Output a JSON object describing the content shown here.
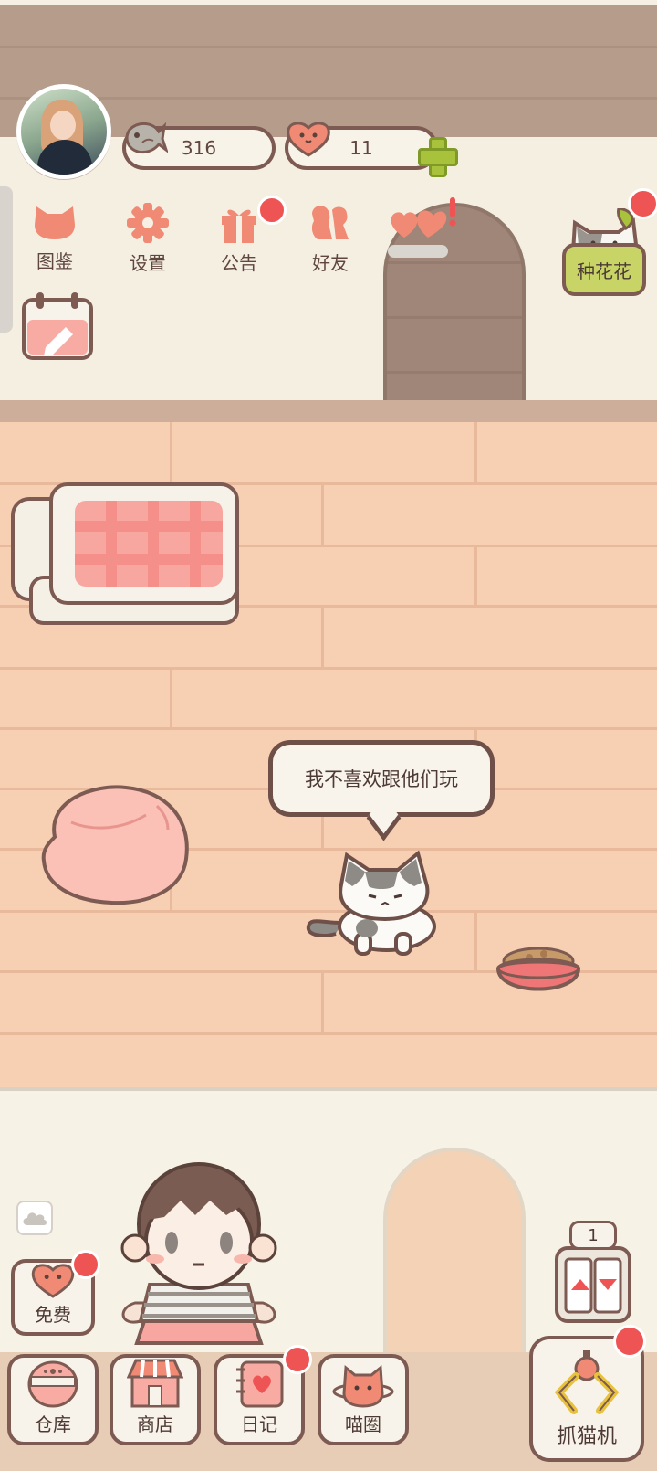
{
  "hud": {
    "fish_count": "316",
    "heart_count": "11"
  },
  "menu": {
    "items": [
      {
        "label": "图鉴",
        "icon": "cat-head-icon"
      },
      {
        "label": "设置",
        "icon": "gear-icon"
      },
      {
        "label": "公告",
        "icon": "gift-icon"
      },
      {
        "label": "好友",
        "icon": "friends-icon"
      }
    ],
    "hearts_icon": "hearts-exclaim-icon",
    "calendar_icon": "calendar-pen-icon"
  },
  "side": {
    "flower_label": "种花花"
  },
  "scene": {
    "speech": "我不喜欢跟他们玩"
  },
  "bottom": {
    "free_label": "免费",
    "floor_number": "1",
    "claw_label": "抓猫机",
    "nav": [
      {
        "label": "仓库",
        "icon": "storage-icon"
      },
      {
        "label": "商店",
        "icon": "shop-icon"
      },
      {
        "label": "日记",
        "icon": "diary-icon"
      },
      {
        "label": "喵圈",
        "icon": "planet-cat-icon"
      }
    ]
  },
  "colors": {
    "accent": "#f08a75",
    "badge": "#ef5454",
    "outline": "#7d5a52",
    "floor": "#f7cfb2"
  }
}
